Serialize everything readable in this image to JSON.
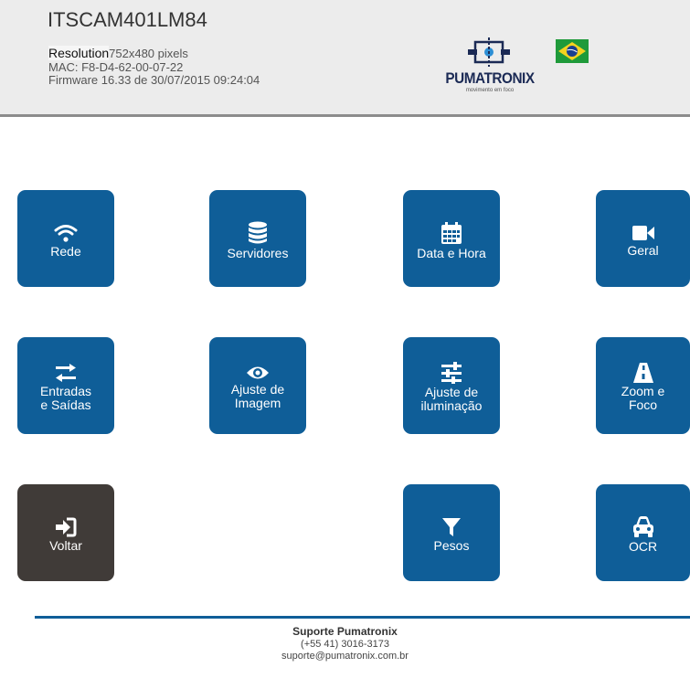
{
  "header": {
    "device_name": "ITSCAM401LM84",
    "resolution_label": "Resolution",
    "resolution_value": "752x480 pixels",
    "mac": "MAC: F8-D4-62-00-07-22",
    "firmware": "Firmware 16.33 de 30/07/2015 09:24:04",
    "brand_name": "PUMATRONIX",
    "brand_tagline": "movimento em foco",
    "language_flag": "brazil-flag"
  },
  "menu": [
    {
      "id": "rede",
      "label": "Rede",
      "icon": "wifi-icon"
    },
    {
      "id": "servidores",
      "label": "Servidores",
      "icon": "database-icon"
    },
    {
      "id": "data-hora",
      "label": "Data e Hora",
      "icon": "calendar-icon"
    },
    {
      "id": "geral",
      "label": "Geral",
      "icon": "video-camera-icon"
    },
    {
      "id": "entradas-saidas",
      "label_line1": "Entradas",
      "label_line2": "e Saídas",
      "icon": "exchange-arrows-icon"
    },
    {
      "id": "ajuste-imagem",
      "label_line1": "Ajuste de",
      "label_line2": "Imagem",
      "icon": "eye-icon"
    },
    {
      "id": "ajuste-iluminacao",
      "label_line1": "Ajuste de",
      "label_line2": "iluminação",
      "icon": "sliders-icon"
    },
    {
      "id": "zoom-foco",
      "label_line1": "Zoom e",
      "label_line2": "Foco",
      "icon": "road-icon"
    },
    {
      "id": "voltar",
      "label": "Voltar",
      "icon": "sign-in-icon"
    },
    {
      "id": "pesos",
      "label": "Pesos",
      "icon": "filter-icon"
    },
    {
      "id": "ocr",
      "label": "OCR",
      "icon": "car-icon"
    }
  ],
  "colors": {
    "tile_blue": "#0f5e98",
    "tile_dark": "#403b38",
    "header_bg": "#ececec"
  },
  "footer": {
    "title": "Suporte Pumatronix",
    "phone": "(+55 41) 3016-3173",
    "email": "suporte@pumatronix.com.br"
  }
}
